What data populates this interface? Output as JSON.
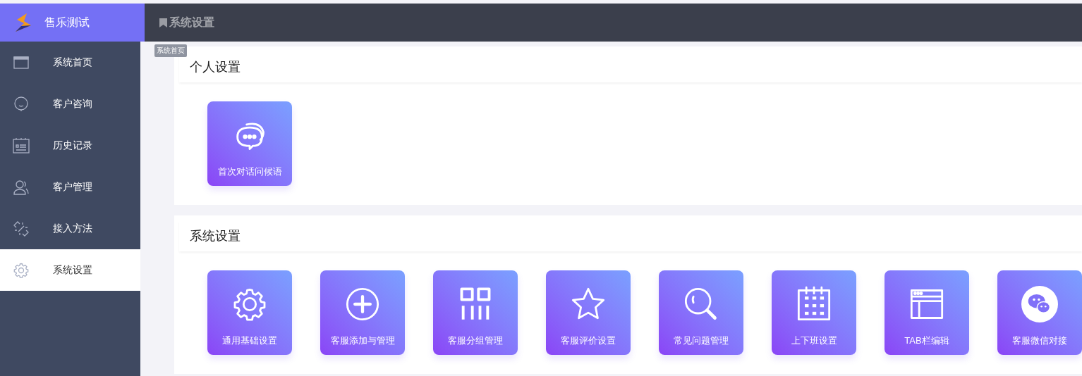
{
  "app": {
    "name": "售乐测试"
  },
  "sidebar": {
    "items": [
      {
        "label": "系统首页",
        "kind": "window",
        "selected": false
      },
      {
        "label": "客户咨询",
        "kind": "smile",
        "selected": false
      },
      {
        "label": "历史记录",
        "kind": "record",
        "selected": false
      },
      {
        "label": "客户管理",
        "kind": "users",
        "selected": false
      },
      {
        "label": "接入方法",
        "kind": "link",
        "selected": false
      },
      {
        "label": "系统设置",
        "kind": "gear",
        "selected": true
      }
    ]
  },
  "header": {
    "title": "系统设置"
  },
  "tooltip": "系统首页",
  "sections": [
    {
      "title": "个人设置",
      "tiles": [
        {
          "label": "首次对话问候语",
          "kind": "chat"
        }
      ]
    },
    {
      "title": "系统设置",
      "tiles": [
        {
          "label": "通用基础设置",
          "kind": "gear"
        },
        {
          "label": "客服添加与管理",
          "kind": "plus"
        },
        {
          "label": "客服分组管理",
          "kind": "grid"
        },
        {
          "label": "客服评价设置",
          "kind": "star"
        },
        {
          "label": "常见问题管理",
          "kind": "search"
        },
        {
          "label": "上下班设置",
          "kind": "calendar"
        },
        {
          "label": "TAB栏编辑",
          "kind": "window"
        },
        {
          "label": "客服微信对接",
          "kind": "wechat"
        }
      ]
    }
  ]
}
